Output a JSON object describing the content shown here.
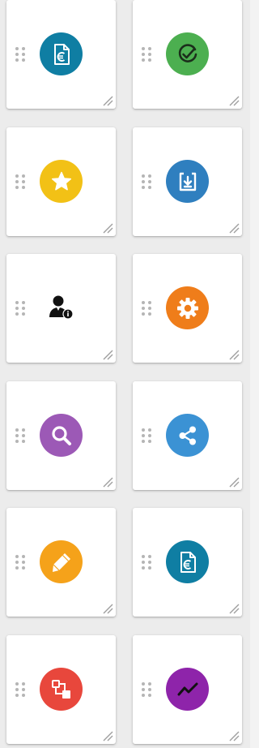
{
  "tiles": [
    {
      "icon": "euro-document-icon",
      "color": "#0f7ea3"
    },
    {
      "icon": "check-circle-icon",
      "color": "#4caf50"
    },
    {
      "icon": "star-icon",
      "color": "#f2c116"
    },
    {
      "icon": "download-box-icon",
      "color": "#2f7fbf"
    },
    {
      "icon": "user-info-icon",
      "color": "#111111"
    },
    {
      "icon": "gear-icon",
      "color": "#ef7d1a"
    },
    {
      "icon": "search-icon",
      "color": "#9c59b6"
    },
    {
      "icon": "share-icon",
      "color": "#3b92d4"
    },
    {
      "icon": "pencil-icon",
      "color": "#f5a21a"
    },
    {
      "icon": "euro-document-icon",
      "color": "#0f7ea3"
    },
    {
      "icon": "workflow-icon",
      "color": "#e8473c"
    },
    {
      "icon": "trend-chart-icon",
      "color": "#8e24aa"
    }
  ]
}
